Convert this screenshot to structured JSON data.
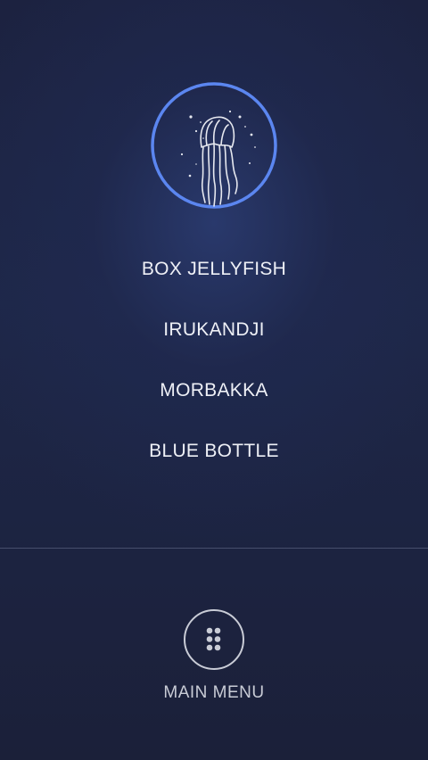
{
  "logo": {
    "icon": "jellyfish-icon",
    "ring_color": "#5b86f0"
  },
  "menu": {
    "items": [
      {
        "label": "BOX JELLYFISH"
      },
      {
        "label": "IRUKANDJI"
      },
      {
        "label": "MORBAKKA"
      },
      {
        "label": "BLUE BOTTLE"
      }
    ]
  },
  "bottom_nav": {
    "icon": "grid-dots-icon",
    "label": "MAIN MENU"
  },
  "colors": {
    "background": "#1e2748",
    "text": "#eef0f6",
    "muted_text": "#c9ccd6",
    "accent": "#5b86f0"
  }
}
